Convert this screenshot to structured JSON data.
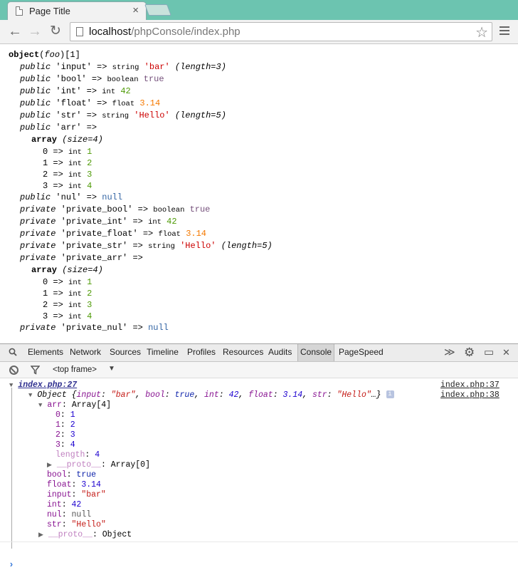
{
  "browser": {
    "tab_title": "Page Title",
    "tab_close": "×",
    "url_host": "localhost",
    "url_path": "/phpConsole/index.php",
    "icons": [
      "back-icon",
      "forward-icon",
      "reload-icon",
      "star-icon",
      "menu-icon"
    ]
  },
  "dump": {
    "header": {
      "kw": "object",
      "cls": "foo",
      "id": "[1]"
    },
    "lines": [
      {
        "vis": "public",
        "key": "'input'",
        "type": "string",
        "val": "'bar'",
        "cls": "str",
        "extra": "(length=3)"
      },
      {
        "vis": "public",
        "key": "'bool'",
        "type": "boolean",
        "val": "true",
        "cls": "bool"
      },
      {
        "vis": "public",
        "key": "'int'",
        "type": "int",
        "val": "42",
        "cls": "num"
      },
      {
        "vis": "public",
        "key": "'float'",
        "type": "float",
        "val": "3.14",
        "cls": "flt"
      },
      {
        "vis": "public",
        "key": "'str'",
        "type": "string",
        "val": "'Hello'",
        "cls": "str",
        "extra": "(length=5)"
      },
      {
        "vis": "public",
        "key": "'arr'",
        "type": "",
        "val": ""
      }
    ],
    "array_label": "array",
    "array_size": "(size=4)",
    "arr_items": [
      {
        "idx": "0",
        "type": "int",
        "val": "1"
      },
      {
        "idx": "1",
        "type": "int",
        "val": "2"
      },
      {
        "idx": "2",
        "type": "int",
        "val": "3"
      },
      {
        "idx": "3",
        "type": "int",
        "val": "4"
      }
    ],
    "nul_line": {
      "vis": "public",
      "key": "'nul'",
      "val": "null"
    },
    "private_lines": [
      {
        "vis": "private",
        "key": "'private_bool'",
        "type": "boolean",
        "val": "true",
        "cls": "bool"
      },
      {
        "vis": "private",
        "key": "'private_int'",
        "type": "int",
        "val": "42",
        "cls": "num"
      },
      {
        "vis": "private",
        "key": "'private_float'",
        "type": "float",
        "val": "3.14",
        "cls": "flt"
      },
      {
        "vis": "private",
        "key": "'private_str'",
        "type": "string",
        "val": "'Hello'",
        "cls": "str",
        "extra": "(length=5)"
      },
      {
        "vis": "private",
        "key": "'private_arr'",
        "type": "",
        "val": ""
      }
    ],
    "private_nul": {
      "vis": "private",
      "key": "'private_nul'",
      "val": "null"
    },
    "arrow": "=>"
  },
  "devtools": {
    "tabs": [
      "Elements",
      "Network",
      "Sources",
      "Timeline",
      "Profiles",
      "Resources",
      "Audits",
      "Console",
      "PageSpeed"
    ],
    "active_tab": "Console",
    "frame": "<top frame>",
    "group_link": "index.php:27",
    "link_37": "index.php:37",
    "link_38": "index.php:38",
    "object_summary": {
      "label": "Object {",
      "input_k": "input",
      "input_v": "\"bar\"",
      "bool_k": "bool",
      "bool_v": "true",
      "int_k": "int",
      "int_v": "42",
      "float_k": "float",
      "float_v": "3.14",
      "str_k": "str",
      "str_v": "\"Hello\"",
      "tail": "…}"
    },
    "arr_label": "arr",
    "arr_type": "Array[4]",
    "arr_entries": [
      {
        "k": "0",
        "v": "1"
      },
      {
        "k": "1",
        "v": "2"
      },
      {
        "k": "2",
        "v": "3"
      },
      {
        "k": "3",
        "v": "4"
      }
    ],
    "length_k": "length",
    "length_v": "4",
    "proto_k": "__proto__",
    "proto_arr": "Array[0]",
    "proto_obj": "Object",
    "props": [
      {
        "k": "bool",
        "v": "true",
        "cls": "ckw"
      },
      {
        "k": "float",
        "v": "3.14",
        "cls": "cnum"
      },
      {
        "k": "input",
        "v": "\"bar\"",
        "cls": "cstr"
      },
      {
        "k": "int",
        "v": "42",
        "cls": "cnum"
      },
      {
        "k": "nul",
        "v": "null",
        "cls": "cgray"
      },
      {
        "k": "str",
        "v": "\"Hello\"",
        "cls": "cstr"
      }
    ],
    "prompt": "›"
  }
}
